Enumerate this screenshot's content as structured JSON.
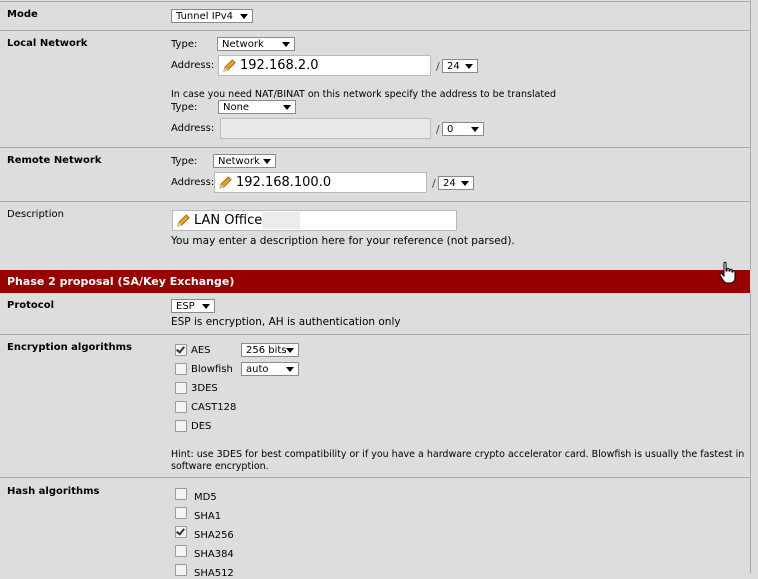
{
  "mode": {
    "label": "Mode",
    "value": "Tunnel IPv4"
  },
  "local_network": {
    "label": "Local Network",
    "type_label": "Type:",
    "type_value": "Network",
    "address_label": "Address:",
    "address_value": "192.168.2.0",
    "slash": "/",
    "mask": "24",
    "nat_hint": "In case you need NAT/BINAT on this network specify the address to be translated",
    "nat_type_label": "Type:",
    "nat_type_value": "None",
    "nat_address_label": "Address:",
    "nat_address_value": "",
    "nat_mask": "0"
  },
  "remote_network": {
    "label": "Remote Network",
    "type_label": "Type:",
    "type_value": "Network",
    "address_label": "Address:",
    "address_value": "192.168.100.0",
    "slash": "/",
    "mask": "24"
  },
  "description": {
    "label": "Description",
    "value": "LAN Office2",
    "hint": "You may enter a description here for your reference (not parsed)."
  },
  "phase2_header": "Phase 2 proposal (SA/Key Exchange)",
  "protocol": {
    "label": "Protocol",
    "value": "ESP",
    "hint": "ESP is encryption, AH is authentication only"
  },
  "encryption": {
    "label": "Encryption algorithms",
    "items": [
      {
        "name": "AES",
        "checked": true,
        "select": "256 bits"
      },
      {
        "name": "Blowfish",
        "checked": false,
        "select": "auto"
      },
      {
        "name": "3DES",
        "checked": false
      },
      {
        "name": "CAST128",
        "checked": false
      },
      {
        "name": "DES",
        "checked": false
      }
    ],
    "hint_line1": "Hint: use 3DES for best compatibility or if you have a hardware crypto accelerator card. Blowfish is usually the fastest in",
    "hint_line2": "software encryption."
  },
  "hash": {
    "label": "Hash algorithms",
    "items": [
      {
        "name": "MD5",
        "checked": false
      },
      {
        "name": "SHA1",
        "checked": false
      },
      {
        "name": "SHA256",
        "checked": true
      },
      {
        "name": "SHA384",
        "checked": false
      },
      {
        "name": "SHA512",
        "checked": false
      }
    ]
  },
  "colors": {
    "header_bg": "#990000",
    "page_bg": "#dddddd"
  }
}
